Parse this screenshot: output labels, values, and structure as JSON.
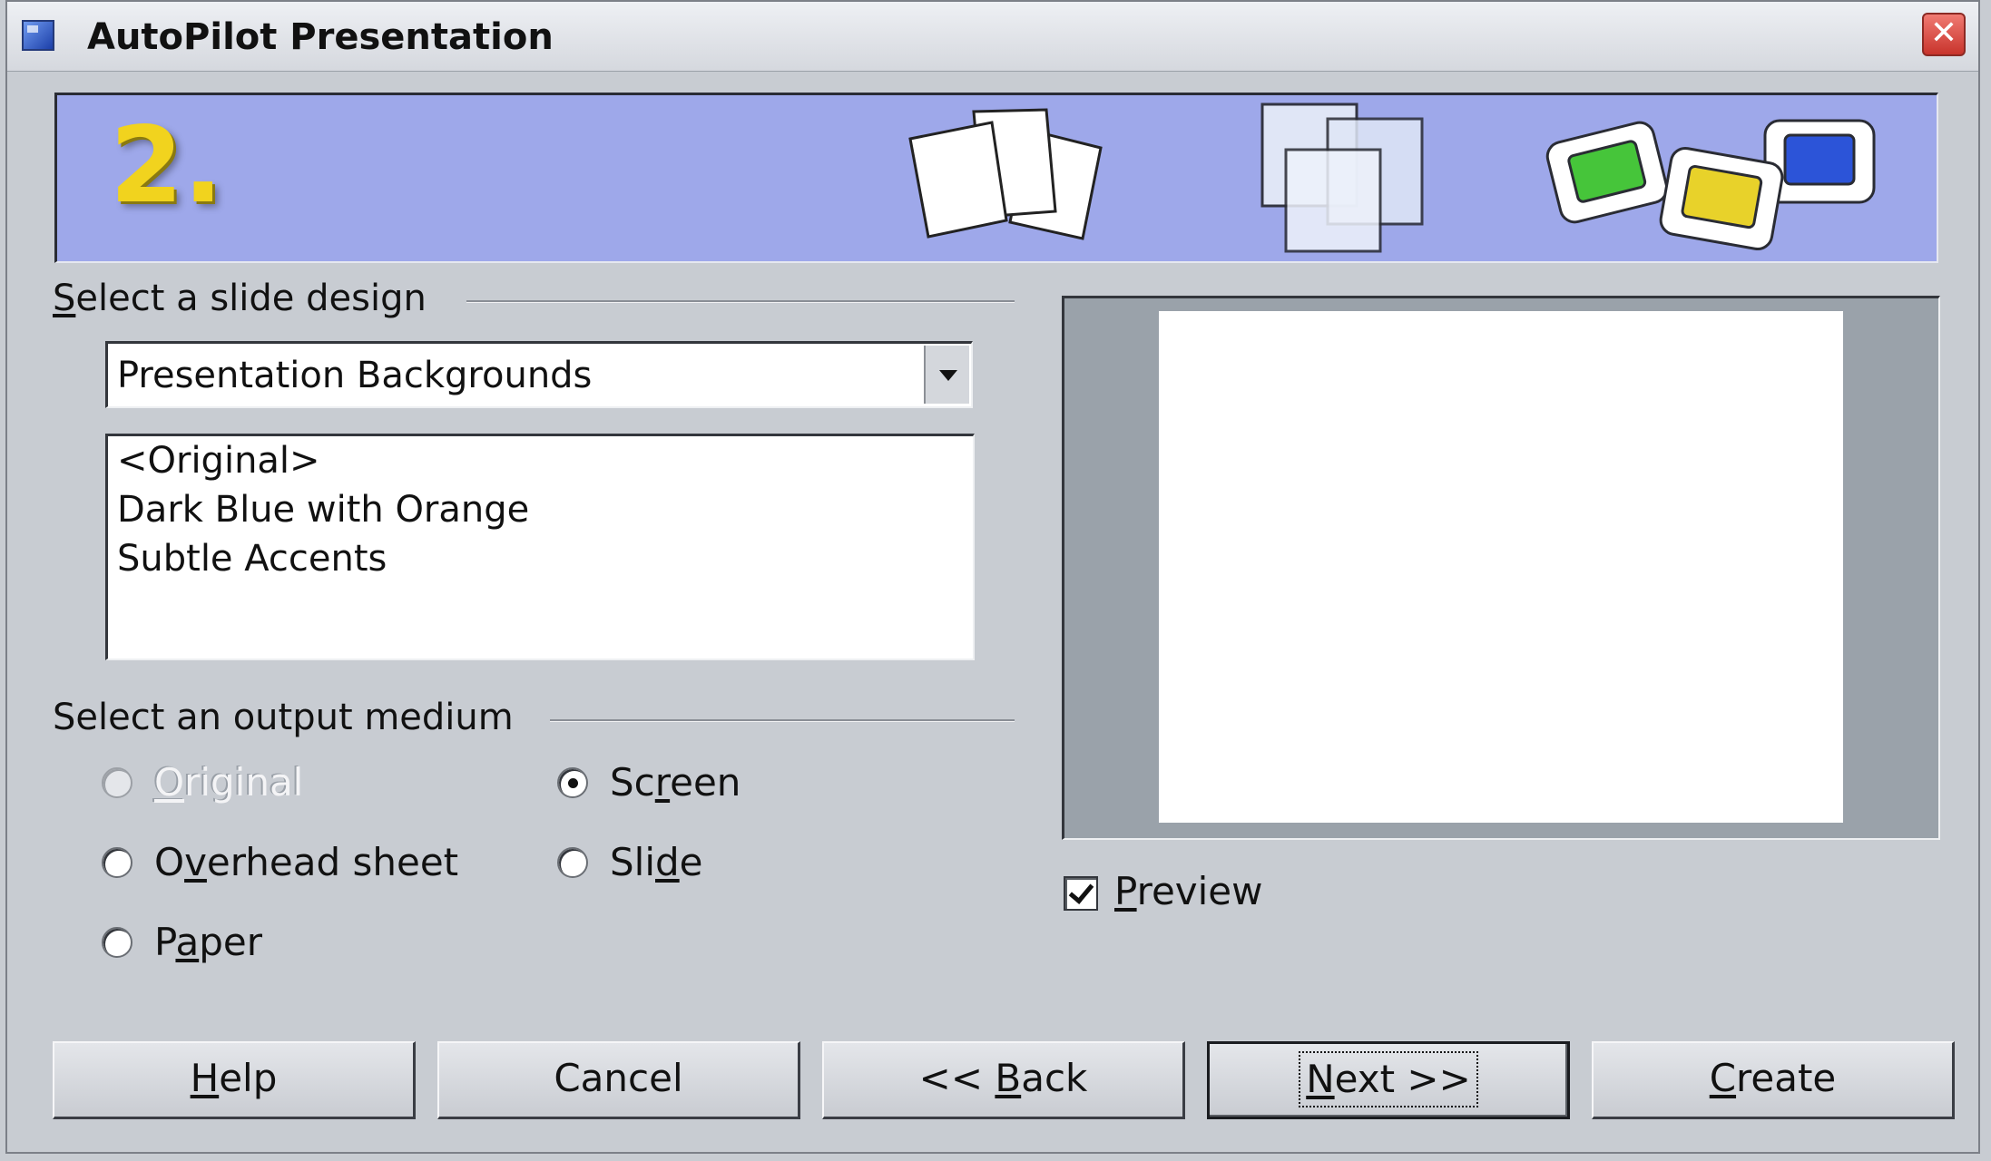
{
  "window": {
    "title": "AutoPilot Presentation",
    "close_symbol": "✕"
  },
  "banner": {
    "step_number": "2."
  },
  "slide_design": {
    "heading_mnemonic": "S",
    "heading_rest": "elect a slide design",
    "category_selected": "Presentation Backgrounds",
    "templates": [
      "<Original>",
      "Dark Blue with Orange",
      "Subtle Accents"
    ]
  },
  "output_medium": {
    "heading": "Select an output medium",
    "options": {
      "original": {
        "pre": "",
        "mn": "O",
        "post": "riginal",
        "selected": false,
        "enabled": false
      },
      "overhead": {
        "pre": "O",
        "mn": "v",
        "post": "erhead sheet",
        "selected": false,
        "enabled": true
      },
      "paper": {
        "pre": "P",
        "mn": "a",
        "post": "per",
        "selected": false,
        "enabled": true
      },
      "screen": {
        "pre": "Sc",
        "mn": "r",
        "post": "een",
        "selected": true,
        "enabled": true
      },
      "slide": {
        "pre": "Sli",
        "mn": "d",
        "post": "e",
        "selected": false,
        "enabled": true
      }
    }
  },
  "preview": {
    "checkbox_mn": "P",
    "checkbox_rest": "review",
    "checked": true
  },
  "buttons": {
    "help": {
      "pre": "",
      "mn": "H",
      "post": "elp"
    },
    "cancel": {
      "label": "Cancel"
    },
    "back": {
      "pre": "<< ",
      "mn": "B",
      "post": "ack"
    },
    "next": {
      "pre": "",
      "mn": "N",
      "post": "ext >>"
    },
    "create": {
      "pre": "",
      "mn": "C",
      "post": "reate"
    }
  },
  "colors": {
    "dialog_bg": "#c8ccd2",
    "banner_bg": "#9ea8ea",
    "step_number": "#f1d31e"
  }
}
